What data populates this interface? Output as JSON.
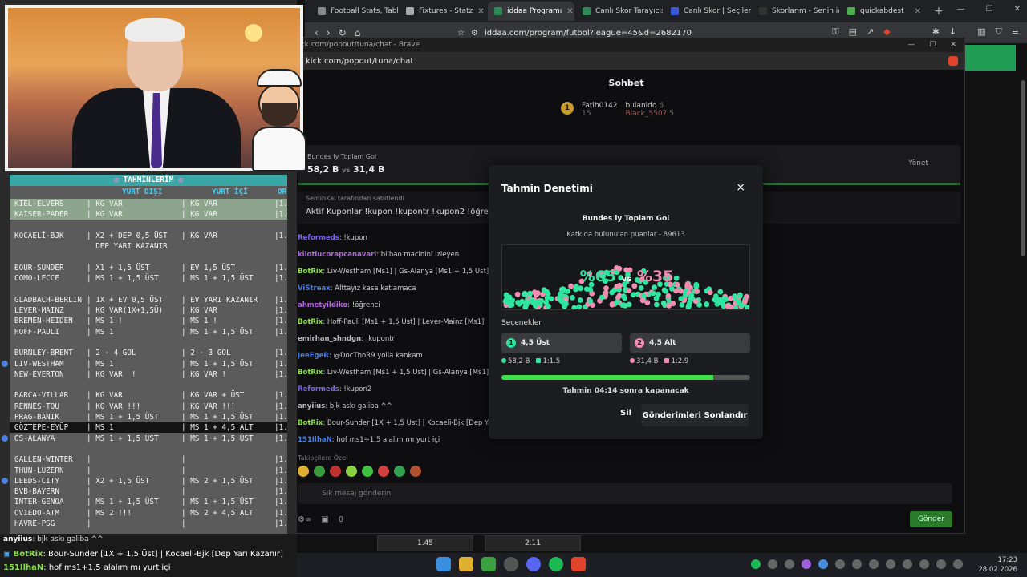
{
  "browser": {
    "tabs": [
      {
        "label": "Football Stats, Tables",
        "color": "#888888"
      },
      {
        "label": "Fixtures - Statz",
        "color": "#aaaaaa"
      },
      {
        "label": "iddaa Programı",
        "color": "#2e8b57"
      },
      {
        "label": "Canlı Skor Tarayıcısı",
        "color": "#2e8b57"
      },
      {
        "label": "Canlı Skor | Seçilen",
        "color": "#3a5bd9"
      },
      {
        "label": "Skorlarım - Senin için",
        "color": "#333333"
      },
      {
        "label": "quickabdest",
        "color": "#4caf50"
      }
    ],
    "url": "iddaa.com/program/futbol?league=45&d=2682170",
    "odds": [
      "1.45",
      "2.11"
    ]
  },
  "popout": {
    "title": "kick.com/popout/tuna/chat - Brave",
    "url": "kick.com/popout/tuna/chat",
    "chat_title": "Sohbet",
    "leaders": [
      {
        "name": "Fatih0142",
        "points": "15"
      },
      {
        "name": "bulanido",
        "points": "6"
      },
      {
        "name": "Black_5507",
        "points": "5"
      }
    ],
    "prediction_bar": {
      "title": "Bundes ly Toplam Gol",
      "value_a": "58,2 B",
      "vs": "vs",
      "value_b": "31,4 B",
      "manage": "Yönet"
    },
    "pinned_by": "SemihKal tarafından sabitlendi",
    "pinned_msg": "Aktif Kuponlar !kupon !kupontr !kupon2 !öğrenci !bun",
    "messages": [
      {
        "user": "Reformeds",
        "text": "!kupon",
        "color": "#7a68d8"
      },
      {
        "user": "kilotlucorapcanavari",
        "text": "bilbao macinini izleyen",
        "color": "#b068d8"
      },
      {
        "user": "BotRix",
        "text": "Liv-Westham [Ms1] | Gs-Alanya [Ms1 + 1,5 Üst]",
        "color": "#8ce04a"
      },
      {
        "user": "ViStreax",
        "text": "Alttayız kasa katlamaca",
        "color": "#4a7ee0"
      },
      {
        "user": "ahmetyildiko",
        "text": "!öğrenci",
        "color": "#b068d8"
      },
      {
        "user": "BotRix",
        "text": "Hoff-Pauli [Ms1 + 1,5 Üst] | Lever-Mainz [Ms1]",
        "color": "#8ce04a"
      },
      {
        "user": "emirhan_shndgn",
        "text": "!kupontr",
        "color": "#bbbbbb"
      },
      {
        "user": "JeeEgeR",
        "text": "@DocThoR9 yolla kankam",
        "color": "#4a7ee0"
      },
      {
        "user": "BotRix",
        "text": "Liv-Westham [Ms1 + 1,5 Üst] | Gs-Alanya [Ms1]",
        "color": "#8ce04a"
      },
      {
        "user": "Reformeds",
        "text": "!kupon2",
        "color": "#7a68d8"
      },
      {
        "user": "anyiius",
        "text": "bjk askı galiba ^^",
        "color": "#bbbbbb"
      },
      {
        "user": "BotRix",
        "text": "Bour-Sunder [1X + 1,5 Üst] | Kocaeli-Bjk [Dep Yarı Kazanır]",
        "color": "#8ce04a"
      },
      {
        "user": "151IlhaN",
        "text": "hof ms1+1.5 alalım mı yurt içi",
        "color": "#4a7ee0"
      }
    ],
    "followers_only": "Takipçilere Özel",
    "input_placeholder": "Sık mesaj gönderin",
    "points": "0",
    "send": "Gönder"
  },
  "modal": {
    "title": "Tahmin Denetimi",
    "close": "×",
    "question": "Bundes ly Toplam Gol",
    "subtitle": "Katkıda bulunulan puanlar - 89613",
    "pct_a": "%65",
    "vs": "vs",
    "pct_b": "%35",
    "options_label": "Seçenekler",
    "options": [
      {
        "num": "1",
        "label": "4,5 Üst",
        "amount": "58,2 B",
        "ratio": "1:1.5",
        "color": "#2ee6a0"
      },
      {
        "num": "2",
        "label": "4,5 Alt",
        "amount": "31,4 B",
        "ratio": "1:2.9",
        "color": "#f28cb0"
      }
    ],
    "progress": 0.85,
    "closing_text": "Tahmin 04:14 sonra kapanacak",
    "delete": "Sil",
    "end_submissions": "Gönderimleri Sonlandır"
  },
  "tips": {
    "header": "TAHMİNLERİM",
    "col_abroad": "YURT DIŞI",
    "col_home": "YURT İÇİ",
    "col_or": "OR",
    "rows": [
      {
        "match": "KIEL-ELVERS",
        "abroad": "| KG VAR",
        "home": "| KG VAR",
        "last": "|1.",
        "style": "hl"
      },
      {
        "match": "KAISER-PADER",
        "abroad": "| KG VAR",
        "home": "| KG VAR",
        "last": "|1.",
        "style": "hl"
      },
      {
        "match": "",
        "abroad": "",
        "home": "",
        "last": "",
        "style": ""
      },
      {
        "match": "KOCAELİ-BJK",
        "abroad": "| X2 + DEP 0,5 ÜST",
        "home": "| KG VAR",
        "last": "|1.",
        "style": ""
      },
      {
        "match": "",
        "abroad": "  DEP YARI KAZANIR",
        "home": "",
        "last": "",
        "style": ""
      },
      {
        "match": "",
        "abroad": "",
        "home": "",
        "last": "",
        "style": ""
      },
      {
        "match": "BOUR-SUNDER",
        "abroad": "| X1 + 1,5 ÜST",
        "home": "| EV 1,5 ÜST",
        "last": "|1.",
        "style": ""
      },
      {
        "match": "COMO-LECCE",
        "abroad": "| MS 1 + 1,5 ÜST",
        "home": "| MS 1 + 1,5 ÜST",
        "last": "|1.",
        "style": ""
      },
      {
        "match": "",
        "abroad": "",
        "home": "",
        "last": "",
        "style": ""
      },
      {
        "match": "GLADBACH-BERLIN",
        "abroad": "| 1X + EV 0,5 ÜST",
        "home": "| EV YARI KAZANIR",
        "last": "|1.",
        "style": ""
      },
      {
        "match": "LEVER-MAINZ",
        "abroad": "| KG VAR(1X+1,5Ü)",
        "home": "| KG VAR",
        "last": "|1.",
        "style": ""
      },
      {
        "match": "BREMEN-HEIDEN",
        "abroad": "| MS 1 !",
        "home": "| MS 1 !",
        "last": "|1.",
        "style": ""
      },
      {
        "match": "HOFF-PAULI",
        "abroad": "| MS 1",
        "home": "| MS 1 + 1,5 ÜST",
        "last": "|1.",
        "style": ""
      },
      {
        "match": "",
        "abroad": "",
        "home": "",
        "last": "",
        "style": ""
      },
      {
        "match": "BURNLEY-BRENT",
        "abroad": "| 2 - 4 GOL",
        "home": "| 2 - 3 GOL",
        "last": "|1.",
        "style": ""
      },
      {
        "match": "LIV-WESTHAM",
        "abroad": "| MS 1",
        "home": "| MS 1 + 1,5 ÜST",
        "last": "|1.",
        "style": "",
        "dot": true
      },
      {
        "match": "NEW-EVERTON",
        "abroad": "| KG VAR  !",
        "home": "| KG VAR !",
        "last": "|1.",
        "style": ""
      },
      {
        "match": "",
        "abroad": "",
        "home": "",
        "last": "",
        "style": ""
      },
      {
        "match": "BARCA-VILLAR",
        "abroad": "| KG VAR",
        "home": "| KG VAR + ÜST",
        "last": "|1.",
        "style": ""
      },
      {
        "match": "RENNES-TOU",
        "abroad": "| KG VAR !!!",
        "home": "| KG VAR !!!",
        "last": "|1.",
        "style": ""
      },
      {
        "match": "PRAG-BANIK",
        "abroad": "| MS 1 + 1,5 ÜST",
        "home": "| MS 1 + 1,5 ÜST",
        "last": "|1.",
        "style": ""
      },
      {
        "match": "GÖZTEPE-EYÜP",
        "abroad": "| MS 1",
        "home": "| MS 1 + 4,5 ALT",
        "last": "|1.",
        "style": "dark"
      },
      {
        "match": "GS-ALANYA",
        "abroad": "| MS 1 + 1,5 ÜST",
        "home": "| MS 1 + 1,5 ÜST",
        "last": "|1.",
        "style": "",
        "dot": true
      },
      {
        "match": "",
        "abroad": "",
        "home": "",
        "last": "",
        "style": ""
      },
      {
        "match": "GALLEN-WINTER",
        "abroad": "|",
        "home": "|",
        "last": "|1.",
        "style": ""
      },
      {
        "match": "THUN-LUZERN",
        "abroad": "|",
        "home": "|",
        "last": "|1.",
        "style": ""
      },
      {
        "match": "LEEDS-CITY",
        "abroad": "| X2 + 1,5 ÜST",
        "home": "| MS 2 + 1,5 ÜST",
        "last": "|1.",
        "style": "",
        "dot": true
      },
      {
        "match": "BVB-BAYERN",
        "abroad": "|",
        "home": "|",
        "last": "|1.",
        "style": ""
      },
      {
        "match": "INTER-GENOA",
        "abroad": "| MS 1 + 1,5 ÜST",
        "home": "| MS 1 + 1,5 ÜST",
        "last": "|1.",
        "style": ""
      },
      {
        "match": "OVIEDO-ATM",
        "abroad": "| MS 2 !!!",
        "home": "| MS 2 + 4,5 ALT",
        "last": "|1.",
        "style": ""
      },
      {
        "match": "HAVRE-PSG",
        "abroad": "|",
        "home": "|",
        "last": "|1.",
        "style": ""
      }
    ]
  },
  "bottom_chat": [
    {
      "user": "anyiius",
      "text": ": bjk askı galiba ^^"
    },
    {
      "user": "BotRix",
      "text": ": Bour-Sunder [1X + 1,5 Üst] | Kocaeli-Bjk [Dep Yarı Kazanır]"
    },
    {
      "user": "151IlhaN",
      "text": ": hof ms1+1.5 alalım mı yurt içi"
    }
  ],
  "taskbar": {
    "time": "17:23",
    "date": "28.02.2026"
  }
}
